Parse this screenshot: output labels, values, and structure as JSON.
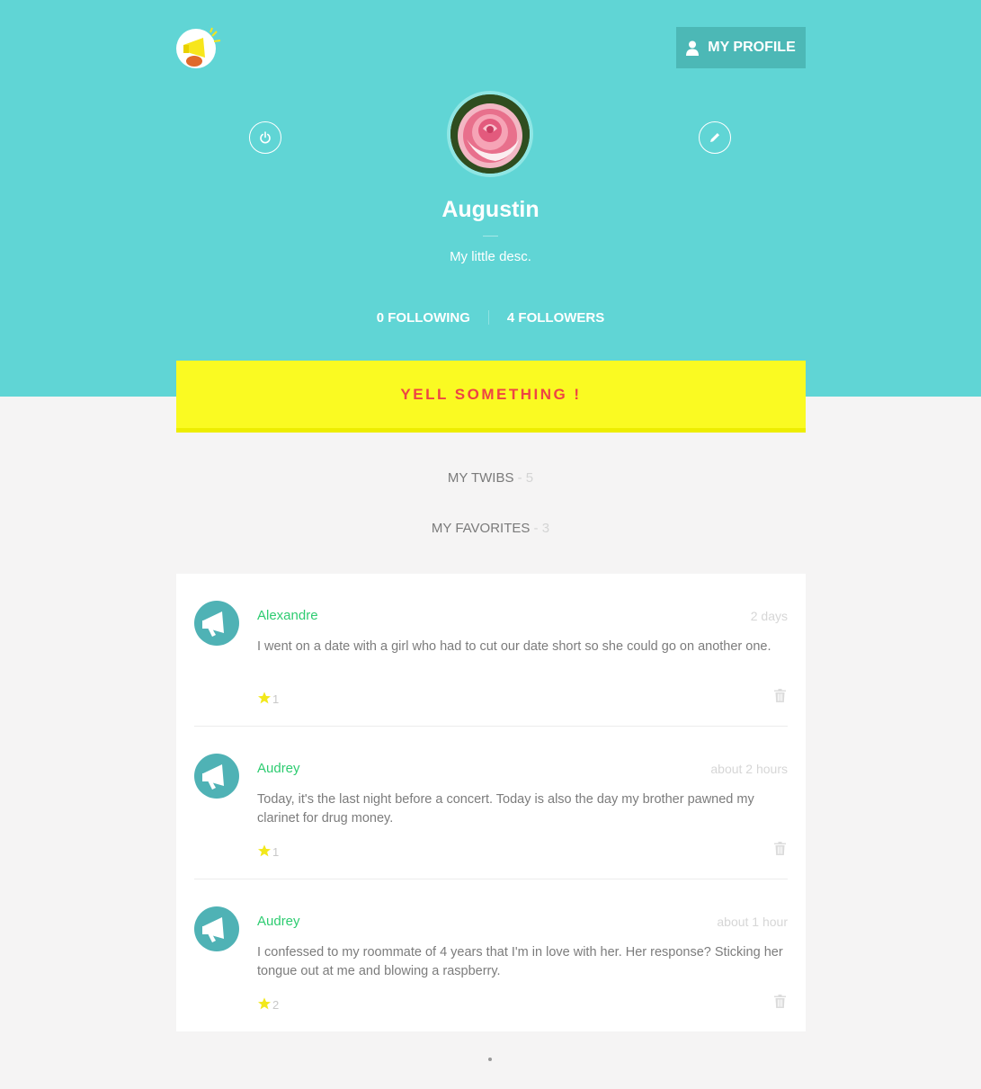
{
  "header": {
    "logo_icon": "megaphone-logo-icon",
    "my_profile_label": "MY PROFILE",
    "my_profile_icon": "user-icon",
    "logout_icon": "power-icon",
    "edit_icon": "pencil-icon"
  },
  "profile": {
    "name": "Augustin",
    "description": "My little desc.",
    "following_label": "0 FOLLOWING",
    "followers_label": "4 FOLLOWERS"
  },
  "yell_button_label": "YELL SOMETHING !",
  "tabs": [
    {
      "label": "MY TWIBS",
      "count": " - 5"
    },
    {
      "label": "MY FAVORITES",
      "count": " - 3"
    }
  ],
  "posts": [
    {
      "author": "Alexandre",
      "time": "2 days",
      "text": "I went on a date with a girl who had to cut our date short so she could go on another one.",
      "favorites": "1"
    },
    {
      "author": "Audrey",
      "time": "about 2 hours",
      "text": "Today, it's the last night before a concert. Today is also the day my brother pawned my clarinet for drug money.",
      "favorites": "1"
    },
    {
      "author": "Audrey",
      "time": "about 1 hour",
      "text": "I confessed to my roommate of 4 years that I'm in love with her. Her response? Sticking her tongue out at me and blowing a raspberry.",
      "favorites": "2"
    }
  ],
  "colors": {
    "hero": "#60d5d5",
    "profile_button": "#4cb8b6",
    "yell_background": "#fafa22",
    "yell_text": "#ee4444",
    "author": "#2ecc71",
    "page_background": "#f5f4f4"
  }
}
